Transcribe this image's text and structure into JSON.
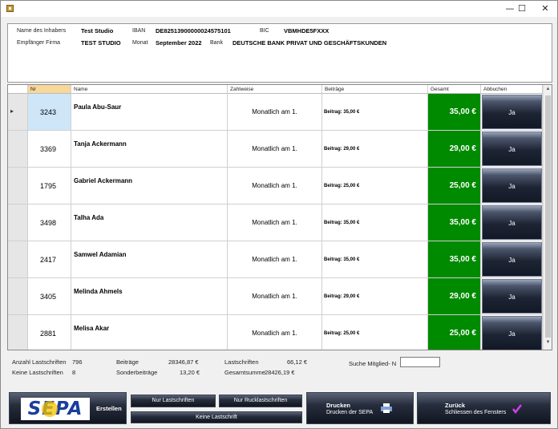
{
  "window": {
    "controls": {
      "minimize": "—",
      "maximize": "☐",
      "close": "✕"
    }
  },
  "info": {
    "owner_label": "Name des Inhabers",
    "owner_value": "Test Studio",
    "iban_label": "IBAN",
    "iban_value": "DE82513900000024575101",
    "bic_label": "BIC",
    "bic_value": "VBMHDE5FXXX",
    "recipient_label": "Empfänger Firma",
    "recipient_value": "TEST STUDIO",
    "month_label": "Monat",
    "month_value": "September 2022",
    "bank_label": "Bank",
    "bank_value": "DEUTSCHE BANK PRIVAT UND GESCHÄFTSKUNDEN"
  },
  "grid": {
    "columns": [
      "Nr",
      "Name",
      "Zahlweise",
      "Beiträge",
      "Gesamt",
      "Abbuchen"
    ],
    "rows": [
      {
        "nr": "3243",
        "name": "Paula Abu-Saur",
        "zahlweise": "Monatlich am 1.",
        "beitrag": "Beitrag: 35,00 €",
        "gesamt": "35,00 €",
        "abbuchen": "Ja"
      },
      {
        "nr": "3369",
        "name": "Tanja Ackermann",
        "zahlweise": "Monatlich am 1.",
        "beitrag": "Beitrag: 29,00 €",
        "gesamt": "29,00 €",
        "abbuchen": "Ja"
      },
      {
        "nr": "1795",
        "name": "Gabriel Ackermann",
        "zahlweise": "Monatlich am 1.",
        "beitrag": "Beitrag: 25,00 €",
        "gesamt": "25,00 €",
        "abbuchen": "Ja"
      },
      {
        "nr": "3498",
        "name": "Talha Ada",
        "zahlweise": "Monatlich am 1.",
        "beitrag": "Beitrag: 35,00 €",
        "gesamt": "35,00 €",
        "abbuchen": "Ja"
      },
      {
        "nr": "2417",
        "name": "Samwel Adamian",
        "zahlweise": "Monatlich am 1.",
        "beitrag": "Beitrag: 35,00 €",
        "gesamt": "35,00 €",
        "abbuchen": "Ja"
      },
      {
        "nr": "3405",
        "name": "Melinda Ahmels",
        "zahlweise": "Monatlich am 1.",
        "beitrag": "Beitrag: 29,00 €",
        "gesamt": "29,00 €",
        "abbuchen": "Ja"
      },
      {
        "nr": "2881",
        "name": "Melisa Akar",
        "zahlweise": "Monatlich am 1.",
        "beitrag": "Beitrag: 25,00 €",
        "gesamt": "25,00 €",
        "abbuchen": "Ja"
      }
    ],
    "selected_row_indicator": "▸",
    "scroll_up": "▲",
    "scroll_down": "▼"
  },
  "summary": {
    "anzahl_label": "Anzahl Lastschriften",
    "anzahl_value": "796",
    "keine_label": "Keine Lastschriften",
    "keine_value": "8",
    "beitraege_label": "Beiträge",
    "beitraege_value": "28346,87 €",
    "sonder_label": "Sonderbeiträge",
    "sonder_value": "13,20 €",
    "lastschriften_label": "Lastschriften",
    "lastschriften_value": "66,12 €",
    "gesamtsumme_label": "Gesamtsumme",
    "gesamtsumme_value": "28426,19 €",
    "suche_label": "Suche Mitglied- N",
    "suche_value": ""
  },
  "buttons": {
    "sepa_logo": "SEPA",
    "erstellen": "Erstellen",
    "nur_lastschriften": "Nur Lastschriften",
    "nur_ruecklastschriften": "Nur Rucklastschriften",
    "keine_lastschrift": "Keine Lastschrift",
    "drucken_title": "Drucken",
    "drucken_sub": "Drucken der SEPA",
    "zurueck_title": "Zurück",
    "zurueck_sub": "Schliessen des Fensters"
  },
  "colors": {
    "gesamt_green": "#008a00",
    "sepa_blue": "#1a3e9c",
    "sepa_yellow": "#f5c400",
    "selected_nr": "#cfe6f8"
  }
}
